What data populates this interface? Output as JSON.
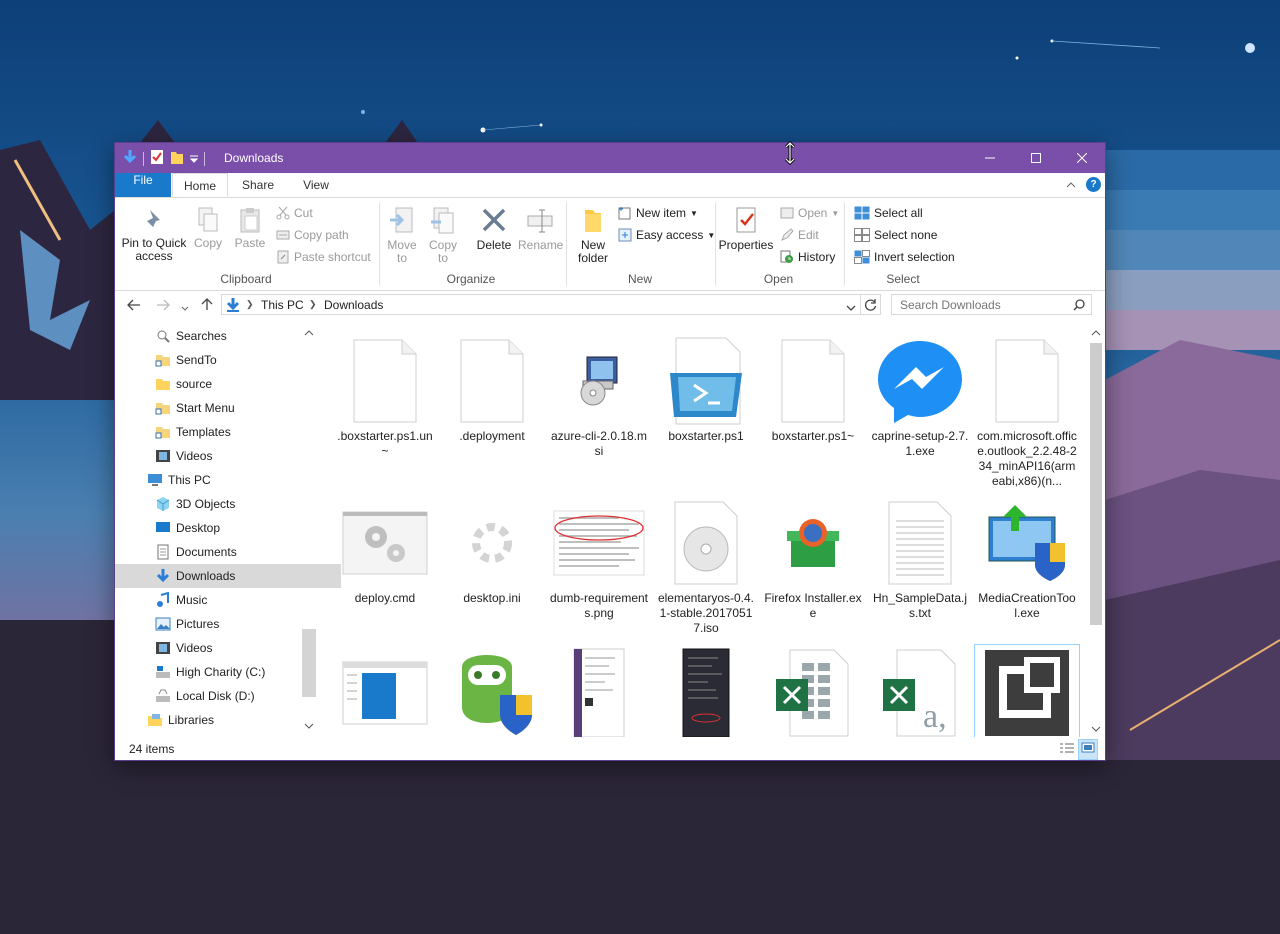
{
  "window": {
    "title": "Downloads"
  },
  "colors": {
    "titlebar": "#7a4faa",
    "file_tab": "#1979ca",
    "selected_nav": "#d9d9d9",
    "accent": "#1979ca"
  },
  "tabs": {
    "file": "File",
    "home": "Home",
    "share": "Share",
    "view": "View"
  },
  "ribbon": {
    "clipboard": {
      "label": "Clipboard",
      "pin": "Pin to Quick access",
      "copy": "Copy",
      "paste": "Paste",
      "cut": "Cut",
      "copy_path": "Copy path",
      "paste_shortcut": "Paste shortcut"
    },
    "organize": {
      "label": "Organize",
      "move_to": "Move to",
      "copy_to": "Copy to",
      "delete": "Delete",
      "rename": "Rename"
    },
    "new": {
      "label": "New",
      "new_folder": "New folder",
      "new_item": "New item",
      "easy_access": "Easy access"
    },
    "open": {
      "label": "Open",
      "properties": "Properties",
      "open": "Open",
      "edit": "Edit",
      "history": "History"
    },
    "select": {
      "label": "Select",
      "select_all": "Select all",
      "select_none": "Select none",
      "invert_selection": "Invert selection"
    }
  },
  "address": {
    "crumbs": [
      "This PC",
      "Downloads"
    ],
    "search_placeholder": "Search Downloads"
  },
  "nav": {
    "items": [
      {
        "label": "Searches",
        "icon": "search-folder-icon"
      },
      {
        "label": "SendTo",
        "icon": "folder-shortcut-icon"
      },
      {
        "label": "source",
        "icon": "folder-icon"
      },
      {
        "label": "Start Menu",
        "icon": "folder-shortcut-icon"
      },
      {
        "label": "Templates",
        "icon": "folder-shortcut-icon"
      },
      {
        "label": "Videos",
        "icon": "videos-icon"
      },
      {
        "label": "This PC",
        "icon": "computer-icon"
      },
      {
        "label": "3D Objects",
        "icon": "3d-objects-icon"
      },
      {
        "label": "Desktop",
        "icon": "desktop-icon"
      },
      {
        "label": "Documents",
        "icon": "documents-icon"
      },
      {
        "label": "Downloads",
        "icon": "downloads-icon"
      },
      {
        "label": "Music",
        "icon": "music-icon"
      },
      {
        "label": "Pictures",
        "icon": "pictures-icon"
      },
      {
        "label": "Videos",
        "icon": "videos-icon"
      },
      {
        "label": "High Charity (C:)",
        "icon": "drive-icon"
      },
      {
        "label": "Local Disk (D:)",
        "icon": "drive-icon"
      },
      {
        "label": "Libraries",
        "icon": "libraries-icon"
      }
    ]
  },
  "files": [
    {
      "name": ".boxstarter.ps1.un~",
      "type": "blank"
    },
    {
      "name": ".deployment",
      "type": "blank"
    },
    {
      "name": "azure-cli-2.0.18.msi",
      "type": "msi"
    },
    {
      "name": "boxstarter.ps1",
      "type": "powershell"
    },
    {
      "name": "boxstarter.ps1~",
      "type": "blank"
    },
    {
      "name": "caprine-setup-2.7.1.exe",
      "type": "messenger"
    },
    {
      "name": "com.microsoft.office.outlook_2.2.48-234_minAPI16(armeabi,x86)(n...",
      "type": "blank"
    },
    {
      "name": "deploy.cmd",
      "type": "cmd"
    },
    {
      "name": "desktop.ini",
      "type": "ini"
    },
    {
      "name": "dumb-requirements.png",
      "type": "png"
    },
    {
      "name": "elementaryos-0.4.1-stable.20170517.iso",
      "type": "iso"
    },
    {
      "name": "Firefox Installer.exe",
      "type": "firefox"
    },
    {
      "name": "Hn_SampleData.js.txt",
      "type": "txt"
    },
    {
      "name": "MediaCreationTool.exe",
      "type": "mediacreation"
    },
    {
      "name": "",
      "type": "window-thumb"
    },
    {
      "name": "",
      "type": "vpn"
    },
    {
      "name": "",
      "type": "phone-light"
    },
    {
      "name": "",
      "type": "phone-dark"
    },
    {
      "name": "",
      "type": "excel"
    },
    {
      "name": "",
      "type": "excel-csv"
    },
    {
      "name": "",
      "type": "app-box"
    }
  ],
  "status": {
    "count": "24 items"
  }
}
